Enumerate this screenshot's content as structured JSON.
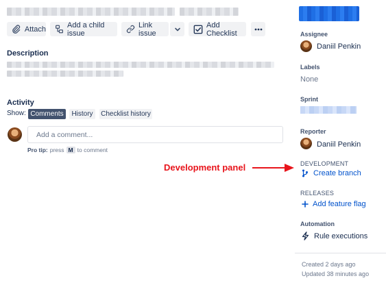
{
  "toolbar": {
    "attach_label": "Attach",
    "child_issue_label": "Add a child issue",
    "link_issue_label": "Link issue",
    "checklist_label": "Add Checklist"
  },
  "description": {
    "heading": "Description"
  },
  "activity": {
    "heading": "Activity",
    "show_label": "Show:",
    "tabs": [
      "Comments",
      "History",
      "Checklist history"
    ],
    "active_tab": "Comments",
    "comment_placeholder": "Add a comment...",
    "pro_tip_bold": "Pro tip:",
    "pro_tip_press": "press",
    "pro_tip_key": "M",
    "pro_tip_suffix": "to comment"
  },
  "annotation": {
    "text": "Development panel",
    "color": "#e8141b"
  },
  "sidebar": {
    "assignee_label": "Assignee",
    "assignee_name": "Daniil Penkin",
    "labels_label": "Labels",
    "labels_value": "None",
    "sprint_label": "Sprint",
    "reporter_label": "Reporter",
    "reporter_name": "Daniil Penkin",
    "development_label": "DEVELOPMENT",
    "create_branch": "Create branch",
    "releases_label": "RELEASES",
    "add_feature_flag": "Add feature flag",
    "automation_label": "Automation",
    "rule_executions": "Rule executions",
    "created": "Created 2 days ago",
    "updated": "Updated 38 minutes ago"
  },
  "colors": {
    "accent": "#0052cc",
    "active_tab_bg": "#42526e",
    "annotation": "#e8141b"
  },
  "icons": [
    "paperclip-icon",
    "child-issue-icon",
    "link-icon",
    "chevron-down-icon",
    "checkbox-icon",
    "more-icon",
    "branch-icon",
    "plus-icon",
    "lightning-icon"
  ]
}
